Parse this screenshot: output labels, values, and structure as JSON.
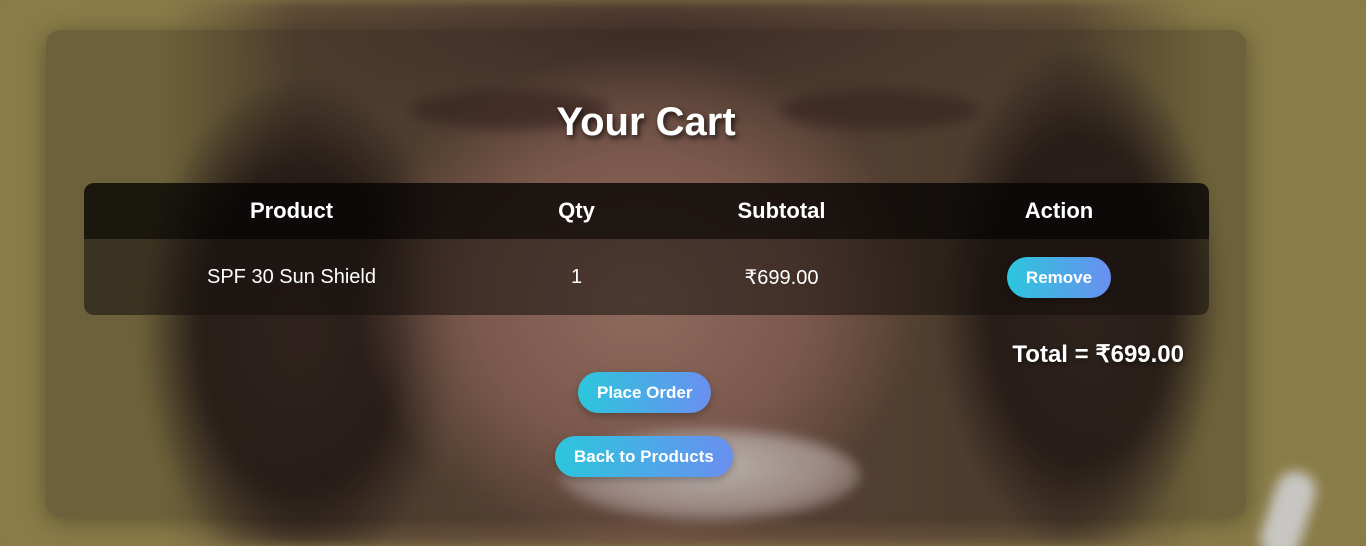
{
  "cart": {
    "title": "Your Cart",
    "columns": [
      "Product",
      "Qty",
      "Subtotal",
      "Action"
    ],
    "items": [
      {
        "product": "SPF 30 Sun Shield",
        "qty": "1",
        "subtotal": "₹699.00",
        "action_label": "Remove"
      }
    ],
    "total_text": "Total = ₹699.00",
    "place_order_label": "Place Order",
    "back_label": "Back to Products"
  },
  "colors": {
    "button_gradient_start": "#2cc6dc",
    "button_gradient_end": "#6a8ff0",
    "text": "#ffffff"
  }
}
